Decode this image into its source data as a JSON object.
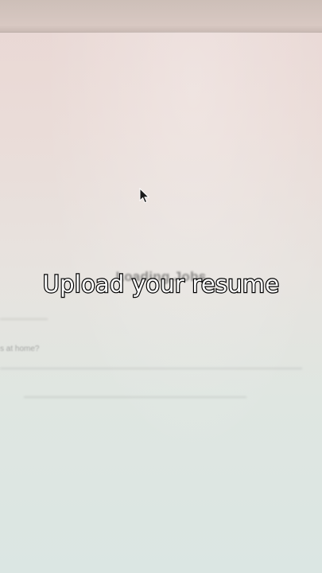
{
  "screen": {
    "status_text": "Loading Jobs",
    "faint_field_label": "s at home?"
  },
  "overlay": {
    "caption": "Upload your resume"
  },
  "icons": {
    "pointer": "mouse-pointer-icon"
  },
  "colors": {
    "caption_text": "#ffffff",
    "caption_outline": "#000000",
    "screen_top": "#e9d7d4",
    "screen_bottom": "#dbe6e3"
  }
}
